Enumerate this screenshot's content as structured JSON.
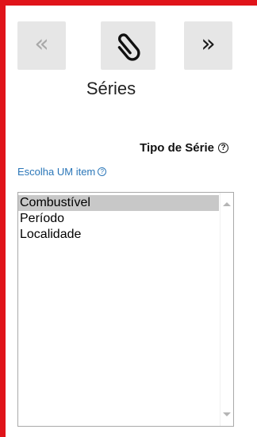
{
  "nav": {
    "prev_glyph": "«",
    "prev_icon": "double-chevron-left-icon",
    "clip_icon": "paperclip-icon",
    "next_glyph": "»",
    "next_icon": "double-chevron-right-icon"
  },
  "title": "Séries",
  "tipo_label": "Tipo de Série",
  "help_glyph": "?",
  "choose_hint": "Escolha UM item",
  "list": {
    "items": [
      "Combustível",
      "Período",
      "Localidade"
    ],
    "selected": "Combustível"
  },
  "colors": {
    "frame": "#e0141a",
    "button_bg": "#e6e6e6",
    "hint_text": "#2a76b8",
    "selected_bg": "#c8c8c8"
  }
}
